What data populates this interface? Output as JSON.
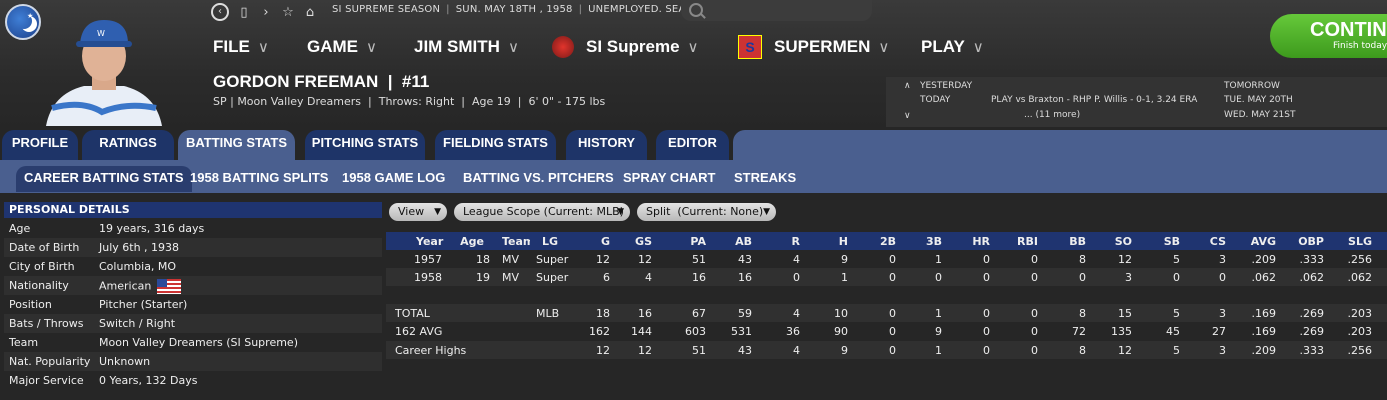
{
  "nav": {
    "back_icon": "back-arrow-icon",
    "forward_icon": "chevron-right-icon",
    "info": [
      "SI SUPREME SEASON",
      "SUN. MAY 18TH , 1958",
      "UNEMPLOYED. SEARCH JOBS..."
    ]
  },
  "menu": {
    "file": "FILE",
    "game": "GAME",
    "manager": "JIM SMITH",
    "league": "SI Supreme",
    "team": "SUPERMEN",
    "play": "PLAY"
  },
  "continue": {
    "label": "CONTINUE",
    "sub": "Finish today"
  },
  "player": {
    "name": "GORDON FREEMAN  |  #11",
    "info": "SP | Moon Valley Dreamers  |  Throws: Right  |  Age 19  |  6' 0\" - 175 lbs"
  },
  "schedule": {
    "yesterday": "YESTERDAY",
    "today": "TODAY",
    "tomorrow": "TOMORROW",
    "today_game": "PLAY vs Braxton - RHP P. Willis - 0-1, 3.24 ERA",
    "more": "... (11 more)",
    "next1": "TUE. MAY 20TH",
    "next2": "WED. MAY 21ST"
  },
  "tabs": [
    "PROFILE",
    "RATINGS",
    "BATTING STATS",
    "PITCHING STATS",
    "FIELDING STATS",
    "HISTORY",
    "EDITOR"
  ],
  "subtabs": [
    "CAREER BATTING STATS",
    "1958 BATTING SPLITS",
    "1958 GAME LOG",
    "BATTING VS. PITCHERS",
    "SPRAY CHART",
    "STREAKS"
  ],
  "personal": {
    "title": "PERSONAL DETAILS",
    "rows": [
      {
        "k": "Age",
        "v": "19 years, 316 days"
      },
      {
        "k": "Date of Birth",
        "v": "July 6th , 1938"
      },
      {
        "k": "City of Birth",
        "v": "Columbia, MO"
      },
      {
        "k": "Nationality",
        "v": "American"
      },
      {
        "k": "Position",
        "v": "Pitcher (Starter)"
      },
      {
        "k": "Bats / Throws",
        "v": "Switch / Right"
      },
      {
        "k": "Team",
        "v": "Moon Valley Dreamers (SI Supreme)"
      },
      {
        "k": "Nat. Popularity",
        "v": "Unknown"
      },
      {
        "k": "Major Service",
        "v": "0 Years, 132 Days"
      }
    ]
  },
  "filters": [
    "View",
    "League Scope (Current: MLB)",
    "Split  (Current: None)"
  ],
  "stats": {
    "headers": [
      "Year",
      "Age",
      "Team",
      "LG",
      "G",
      "GS",
      "PA",
      "AB",
      "R",
      "H",
      "2B",
      "3B",
      "HR",
      "RBI",
      "BB",
      "SO",
      "SB",
      "CS",
      "AVG",
      "OBP",
      "SLG"
    ],
    "rows": [
      [
        "1957",
        "18",
        "MV",
        "Super",
        "12",
        "12",
        "51",
        "43",
        "4",
        "9",
        "0",
        "1",
        "0",
        "0",
        "8",
        "12",
        "5",
        "3",
        ".209",
        ".333",
        ".256"
      ],
      [
        "1958",
        "19",
        "MV",
        "Super",
        "6",
        "4",
        "16",
        "16",
        "0",
        "1",
        "0",
        "0",
        "0",
        "0",
        "0",
        "3",
        "0",
        "0",
        ".062",
        ".062",
        ".062"
      ],
      [
        "",
        "",
        "",
        "",
        "",
        "",
        "",
        "",
        "",
        "",
        "",
        "",
        "",
        "",
        "",
        "",
        "",
        "",
        "",
        "",
        ""
      ],
      [
        "TOTAL",
        "",
        "",
        "MLB",
        "18",
        "16",
        "67",
        "59",
        "4",
        "10",
        "0",
        "1",
        "0",
        "0",
        "8",
        "15",
        "5",
        "3",
        ".169",
        ".269",
        ".203"
      ],
      [
        "162 AVG",
        "",
        "",
        "",
        "162",
        "144",
        "603",
        "531",
        "36",
        "90",
        "0",
        "9",
        "0",
        "0",
        "72",
        "135",
        "45",
        "27",
        ".169",
        ".269",
        ".203"
      ],
      [
        "Career Highs",
        "",
        "",
        "",
        "12",
        "12",
        "51",
        "43",
        "4",
        "9",
        "0",
        "1",
        "0",
        "0",
        "8",
        "12",
        "5",
        "3",
        ".209",
        ".333",
        ".256"
      ]
    ]
  }
}
